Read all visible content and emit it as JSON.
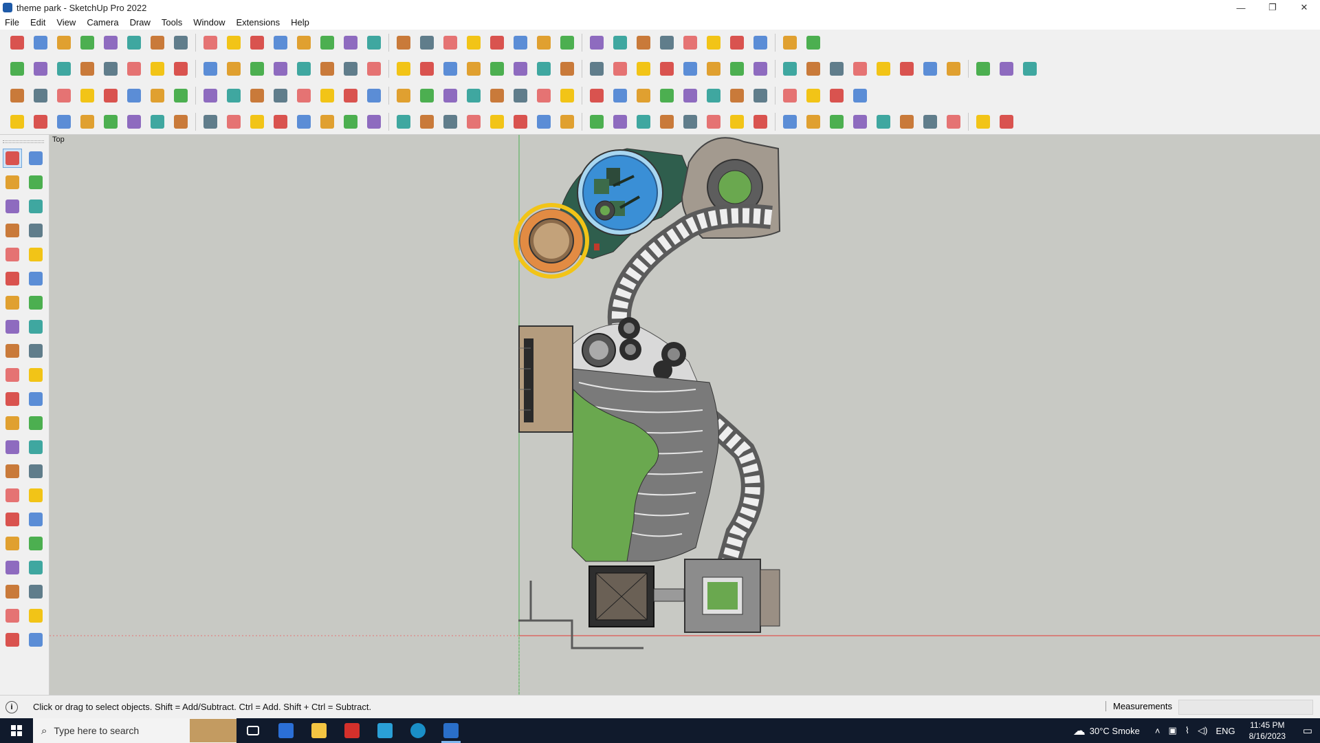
{
  "window": {
    "title": "theme park - SketchUp Pro 2022",
    "minimize": "—",
    "restore": "❐",
    "close": "✕"
  },
  "menu": [
    "File",
    "Edit",
    "View",
    "Camera",
    "Draw",
    "Tools",
    "Window",
    "Extensions",
    "Help"
  ],
  "viewport": {
    "scene_label": "Top"
  },
  "status": {
    "info_icon": "i",
    "message": "Click or drag to select objects. Shift = Add/Subtract. Ctrl = Add. Shift + Ctrl = Subtract.",
    "measurements_label": "Measurements"
  },
  "taskbar": {
    "search_placeholder": "Type here to search",
    "search_glyph": "⌕",
    "weather_glyph": "☁",
    "weather": "30°C  Smoke",
    "language": "ENG",
    "time": "11:45 PM",
    "date": "8/16/2023",
    "notification_glyph": "▭",
    "tray_glyphs": {
      "chevron": "˄",
      "network": "⌇",
      "volume": "◁)",
      "display": "▣"
    }
  },
  "colors": {
    "viewport_bg": "#c8c9c4",
    "axis_green": "#4caf50",
    "axis_red": "#e53935",
    "grass": "#6aa84f",
    "water": "#3a8fd6",
    "path": "#8c8c8c"
  },
  "toolbar_icons": {
    "row1": [
      "zoom-icon",
      "select-icon",
      "eraser-icon",
      "pencil-icon",
      "freehand-icon",
      "shape-icon",
      "pushpull-icon",
      "followme-icon",
      "move-icon",
      "rotate-icon",
      "scale-icon",
      "tape-icon",
      "text-icon",
      "paint-icon",
      "orbit-icon",
      "pan-icon",
      "zoom-window-icon",
      "zoom-extents-icon",
      "iso-view-icon",
      "top-view-icon",
      "front-view-icon",
      "right-view-icon",
      "camera-icon",
      "layer-icon",
      "section-icon",
      "axes-icon",
      "dimension-icon",
      "arrow-up-icon",
      "arrow-down-icon",
      "guide-icon",
      "xray-icon",
      "undo-icon",
      "redo-icon",
      "warehouse-icon"
    ],
    "row2": [
      "box-icon",
      "cylinder-icon",
      "sphere-icon",
      "solid-union-icon",
      "solid-subtract-icon",
      "solid-intersect-icon",
      "trim-icon",
      "split-icon",
      "outer-shell-icon",
      "extrude-icon",
      "section-plane-icon",
      "section-cut-icon",
      "section-fill-icon",
      "roof-icon",
      "roof2-icon",
      "house-icon",
      "house2-icon",
      "house3-icon",
      "house4-icon",
      "house5-icon",
      "function-icon",
      "sandbox-icon",
      "smoove-icon",
      "stamp-icon",
      "drape-icon",
      "circle-icon",
      "polygon-icon",
      "ellipse-icon",
      "parallelogram-icon",
      "arc-icon",
      "spiral-icon",
      "curve-icon",
      "bezier-icon",
      "loft-icon",
      "gradient-icon",
      "eraser2-icon",
      "texture-icon",
      "mesh-icon",
      "terrain-icon",
      "contour-icon",
      "rock-icon",
      "tile-icon",
      "brick-icon"
    ],
    "row3": [
      "cube-blue-icon",
      "plane-icon",
      "plane2-icon",
      "plane3-icon",
      "component-icon",
      "extension-icon",
      "rotate2-icon",
      "rect-red-icon",
      "stairs-icon",
      "door-icon",
      "wall-icon",
      "curve2-icon",
      "join-icon",
      "edge-icon",
      "move-cross-icon",
      "copy-cross-icon",
      "scale-cross-icon",
      "cone-icon",
      "cone2-icon",
      "triangle-icon",
      "lasso-icon",
      "lasso2-icon",
      "lasso3-icon",
      "snap-icon",
      "paint-bucket-icon",
      "loop-icon",
      "grid-icon",
      "box2-icon",
      "box3-icon",
      "gear2-icon",
      "window-icon",
      "pattern-icon",
      "pattern2-icon",
      "dots-icon",
      "circle-dots-icon",
      "array-icon"
    ],
    "row4": [
      "line-tool-icon",
      "polyline-icon",
      "offset-icon",
      "ruby-icon",
      "eye-icon",
      "duplicate-icon",
      "curtain-icon",
      "wireframe-icon",
      "hand-icon",
      "pipe-icon",
      "profile-icon",
      "corner-icon",
      "step-icon",
      "stair2-icon",
      "railing-icon",
      "pergola-icon",
      "window2-icon",
      "roof3-icon",
      "column-icon",
      "fence-icon",
      "fence2-icon",
      "railing2-icon",
      "chair-icon",
      "table-icon",
      "lamp-icon",
      "bench-icon",
      "tree-icon",
      "shrub-icon",
      "vase-icon",
      "flower-icon",
      "pool-icon",
      "fountain-icon",
      "arch-icon",
      "bridge-icon",
      "deck-icon",
      "pillar-icon",
      "trellis-icon",
      "grill-icon",
      "light-icon",
      "sign-icon",
      "planter-icon",
      "house6-icon"
    ]
  },
  "palette_icons": [
    "select-tool-icon",
    "orbit-tool-icon",
    "paint-bucket-tool-icon",
    "eraser-tool-icon",
    "component-tool-icon",
    "tag-tool-icon",
    "line-tool-icon",
    "freehand-tool-icon",
    "rectangle-tool-icon",
    "rotated-rectangle-tool-icon",
    "circle-tool-icon",
    "polygon-tool-icon",
    "arc-tool-icon",
    "two-point-arc-tool-icon",
    "three-point-arc-tool-icon",
    "pie-tool-icon",
    "move-tool-icon",
    "pushpull-tool-icon",
    "rotate-tool-icon",
    "followme-tool-icon",
    "scale-tool-icon",
    "offset-tool-icon",
    "tape-tool-icon",
    "dimension-tool-icon",
    "protractor-tool-icon",
    "text-tool-icon",
    "axes-tool-icon",
    "3dtext-tool-icon",
    "orbit2-tool-icon",
    "pan-tool-icon",
    "zoom-tool-icon",
    "zoom-window-tool-icon",
    "zoom-extents-tool-icon",
    "prev-view-tool-icon",
    "position-camera-tool-icon",
    "look-around-tool-icon",
    "walk-tool-icon",
    "section-tool-icon",
    "section-display-tool-icon",
    "section-fill-tool-icon",
    "layers-tool-icon",
    "layers2-tool-icon"
  ]
}
